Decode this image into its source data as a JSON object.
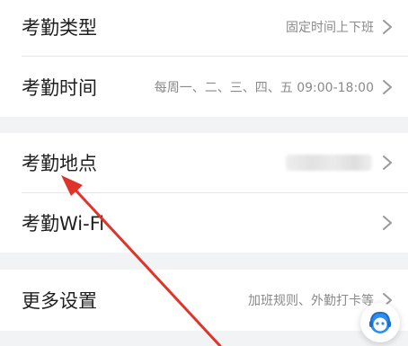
{
  "rows": {
    "type": {
      "label": "考勤类型",
      "value": "固定时间上下班"
    },
    "time": {
      "label": "考勤时间",
      "value": "每周一、二、三、四、五 09:00-18:00"
    },
    "location": {
      "label": "考勤地点",
      "value": ""
    },
    "wifi": {
      "label": "考勤Wi-Fi",
      "value": ""
    },
    "more": {
      "label": "更多设置",
      "value": "加班规则、外勤打卡等"
    }
  },
  "colors": {
    "annotation_arrow": "#e0332a",
    "page_bg": "#f2f3f5",
    "assistant_icon": "#2a8df0"
  },
  "icons": {
    "chevron": "chevron-right-icon",
    "assistant": "customer-service-icon"
  }
}
